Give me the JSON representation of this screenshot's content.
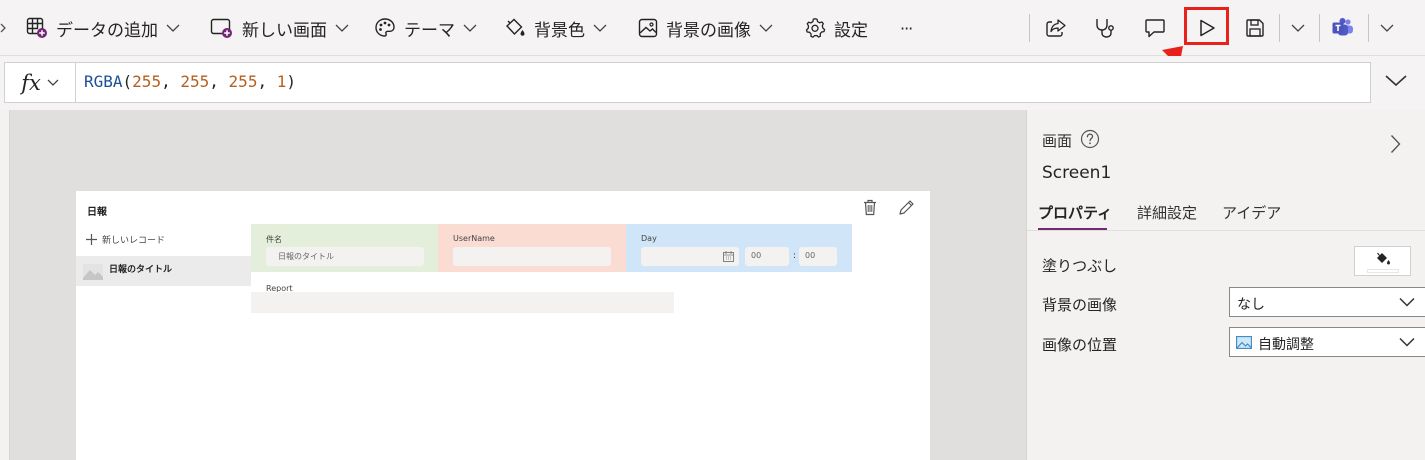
{
  "toolbar": {
    "add_data": "データの追加",
    "new_screen": "新しい画面",
    "theme": "テーマ",
    "background_color": "背景色",
    "background_image": "背景の画像",
    "settings": "設定",
    "more": "···"
  },
  "formula_bar": {
    "fx_label": "fx",
    "fn": "RGBA",
    "open_paren": "(",
    "r": "255",
    "g": "255",
    "b": "255",
    "a": "1",
    "comma": ",",
    "close_paren": ")"
  },
  "canvas": {
    "sidebar_title": "日報",
    "new_record": "新しいレコード",
    "list_item": "日報のタイトル",
    "subject_label": "件名",
    "subject_placeholder": "日報のタイトル",
    "username_label": "UserName",
    "day_label": "Day",
    "hour": "00",
    "minute": "00",
    "time_separator": ":",
    "report_label": "Report"
  },
  "properties": {
    "object_type": "画面",
    "screen_name": "Screen1",
    "tabs": {
      "properties": "プロパティ",
      "advanced": "詳細設定",
      "ideas": "アイデア"
    },
    "fill_label": "塗りつぶし",
    "background_image_label": "背景の画像",
    "background_image_value": "なし",
    "image_position_label": "画像の位置",
    "image_position_value": "自動調整"
  },
  "colors": {
    "accent": "#742774",
    "highlight": "#e8221b",
    "fill_value": "#ffffff"
  }
}
